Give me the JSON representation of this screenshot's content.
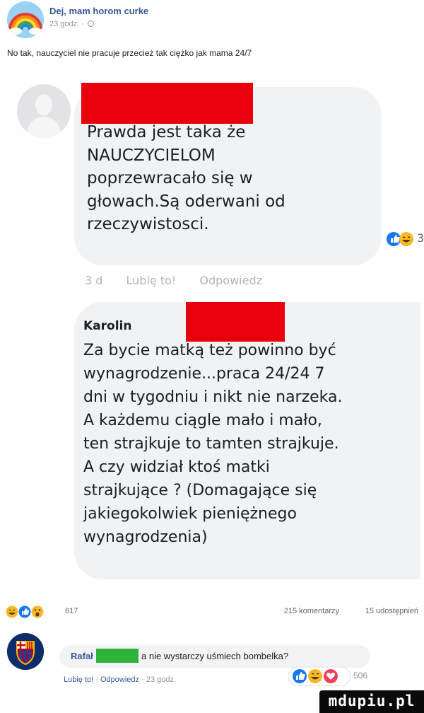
{
  "post": {
    "page_name": "Dej, mam horom curke",
    "time": "23 godz. ·",
    "caption": "No tak, nauczyciel nie pracuje przecież tak ciężko jak mama 24/7"
  },
  "shared_image": {
    "comment_1": {
      "lines": [
        "Prawda jest taka że",
        "NAUCZYCIELOM",
        "poprzewracało się w",
        "głowach.Są oderwani od",
        "rzeczywistosci."
      ],
      "reaction_count": "3"
    },
    "comment_1_actions": {
      "age": "3 d",
      "like": "Lubię to!",
      "reply": "Odpowiedz"
    },
    "comment_2": {
      "author_visible": "Karolin",
      "lines": [
        "Za bycie matką też powinno być",
        "wynagrodzenie...praca 24/24 7",
        "dni w tygodniu i nikt nie narzeka.",
        "A każdemu ciągle mało i mało,",
        "ten strajkuje to tamten strajkuje.",
        "A czy widział ktoś matki",
        "strajkujące ? (Domagające się",
        "jakiegokolwiek pieniężnego",
        "wynagrodzenia)"
      ]
    }
  },
  "reactions_bar": {
    "reaction_count": "617",
    "comments": "215 komentarzy",
    "shares": "15 udostępnień"
  },
  "comment": {
    "author": "Rafał",
    "text": "a nie wystarczy uśmiech bombelka?",
    "like": "Lubię to!",
    "reply": "Odpowiedz",
    "time": "23 godz.",
    "reaction_count": "506"
  },
  "watermark": {
    "text": "mdupiu.pl"
  },
  "colors": {
    "link_blue": "#385898",
    "redaction_red": "#e8000d",
    "redaction_green": "#2db33a",
    "like_blue": "#1877f2",
    "haha_yellow": "#f7b928",
    "angry_red": "#e9710f"
  }
}
